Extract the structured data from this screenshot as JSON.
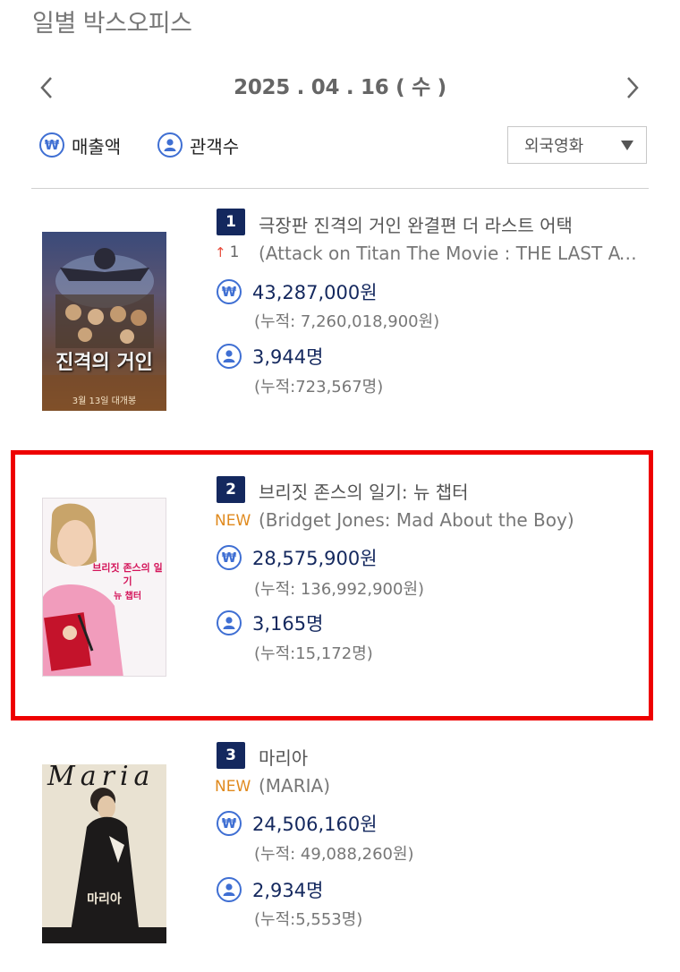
{
  "header": {
    "title": "일별 박스오피스",
    "date": "2025 . 04 . 16 ( 수 )"
  },
  "controls": {
    "sort_revenue": "매출액",
    "sort_audience": "관객수",
    "filter_value": "외국영화",
    "accent_color": "#3f6fd3",
    "badge_color": "#14285e",
    "highlight_color": "#ee0000"
  },
  "movies": [
    {
      "rank": "1",
      "change_arrow": "↑",
      "change": "1",
      "title_ko": "극장판 진격의 거인 완결편 더 라스트 어택",
      "title_en": "(Attack on Titan The Movie : THE LAST ATTACK)",
      "revenue": "43,287,000원",
      "revenue_cum": "(누적: 7,260,018,900원)",
      "audience": "3,944명",
      "audience_cum": "(누적:723,567명)",
      "poster_text": "진격의 거인",
      "poster_subtext": "3월 13일 대개봉"
    },
    {
      "rank": "2",
      "change": "NEW",
      "title_ko": "브리짓 존스의 일기: 뉴 챕터",
      "title_en": "(Bridget Jones: Mad About the Boy)",
      "revenue": "28,575,900원",
      "revenue_cum": "(누적: 136,992,900원)",
      "audience": "3,165명",
      "audience_cum": "(누적:15,172명)",
      "poster_text": "브리짓 존스의 일기",
      "poster_subtext": "뉴 챕터"
    },
    {
      "rank": "3",
      "change": "NEW",
      "title_ko": "마리아",
      "title_en": "(MARIA)",
      "revenue": "24,506,160원",
      "revenue_cum": "(누적: 49,088,260원)",
      "audience": "2,934명",
      "audience_cum": "(누적:5,553명)",
      "poster_text": "마리아",
      "poster_script": "Maria"
    }
  ]
}
